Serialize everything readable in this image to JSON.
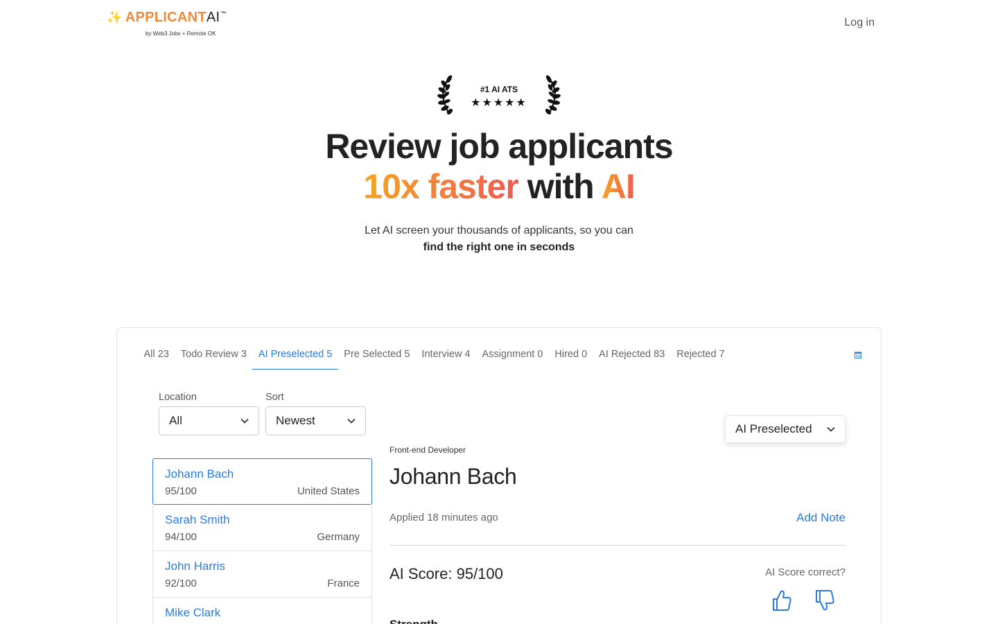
{
  "header": {
    "logo_spark": "✨",
    "logo_word": "APPLICANT",
    "logo_ai": "AI",
    "logo_tm": "™",
    "logo_sub": "by Web3 Jobs + Remote OK",
    "login_label": "Log in"
  },
  "hero": {
    "award_text": "#1 AI ATS",
    "award_stars": "★★★★★",
    "title_line1": "Review job applicants",
    "title_grad1": "10x faster",
    "title_mid": "with",
    "title_grad2": "AI",
    "subtitle_line1": "Let AI screen your thousands of applicants, so you can",
    "subtitle_line2": "find the right one in seconds"
  },
  "tabs": [
    {
      "label": "All 23"
    },
    {
      "label": "Todo Review 3"
    },
    {
      "label": "AI Preselected 5"
    },
    {
      "label": "Pre Selected 5"
    },
    {
      "label": "Interview 4"
    },
    {
      "label": "Assignment 0"
    },
    {
      "label": "Hired 0"
    },
    {
      "label": "AI Rejected 83"
    },
    {
      "label": "Rejected 7"
    }
  ],
  "filters": {
    "location_label": "Location",
    "location_value": "All",
    "sort_label": "Sort",
    "sort_value": "Newest"
  },
  "applicants": [
    {
      "name": "Johann Bach",
      "score": "95/100",
      "country": "United States"
    },
    {
      "name": "Sarah Smith",
      "score": "94/100",
      "country": "Germany"
    },
    {
      "name": "John Harris",
      "score": "92/100",
      "country": "France"
    },
    {
      "name": "Mike Clark",
      "score": "",
      "country": ""
    }
  ],
  "detail": {
    "status": "AI Preselected",
    "role": "Front-end Developer",
    "name": "Johann Bach",
    "applied": "Applied 18 minutes ago",
    "add_note": "Add Note",
    "score": "AI Score: 95/100",
    "score_correct": "AI Score correct?",
    "strength": "Strength"
  },
  "colors": {
    "accent": "#2a7ae2",
    "gradient_start": "#f5a623",
    "gradient_end": "#ee5a52"
  }
}
